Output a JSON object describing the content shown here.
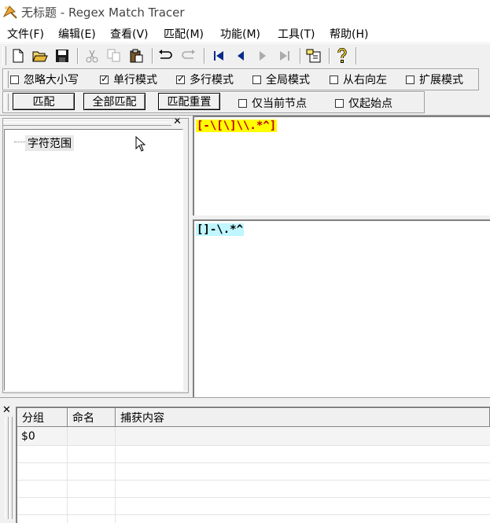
{
  "window": {
    "title": "无标题 - Regex Match Tracer"
  },
  "menu": [
    "文件(F)",
    "编辑(E)",
    "查看(V)",
    "匹配(M)",
    "功能(M)",
    "工具(T)",
    "帮助(H)"
  ],
  "toolbar": {
    "buttons": [
      "new-file",
      "open-folder",
      "save",
      "cut",
      "copy",
      "paste",
      "undo",
      "redo",
      "first",
      "previous",
      "next",
      "last",
      "insert",
      "help"
    ]
  },
  "options": {
    "ignore_case": {
      "label": "忽略大小写",
      "checked": false
    },
    "single_line": {
      "label": "单行模式",
      "checked": true
    },
    "multi_line": {
      "label": "多行模式",
      "checked": true
    },
    "global": {
      "label": "全局模式",
      "checked": false
    },
    "right_to_left": {
      "label": "从右向左",
      "checked": false
    },
    "extended": {
      "label": "扩展模式",
      "checked": false
    }
  },
  "actions": {
    "match": "匹配",
    "match_all": "全部匹配",
    "match_reset": "匹配重置",
    "current_node_only": {
      "label": "仅当前节点",
      "checked": false
    },
    "start_only": {
      "label": "仅起始点",
      "checked": false
    }
  },
  "tree": {
    "root": "字符范围"
  },
  "editor": {
    "pattern": "[-\\[\\]\\\\.*^]",
    "test_text": "[]-\\.*^"
  },
  "results": {
    "columns": [
      "分组",
      "命名",
      "捕获内容"
    ],
    "rows": [
      {
        "group": "$0",
        "name": "",
        "capture": ""
      }
    ]
  },
  "colors": {
    "pattern_bg": "#ffff00",
    "pattern_fg": "#c00000",
    "match_bg": "#bff6ff",
    "match_fg": "#000000"
  }
}
